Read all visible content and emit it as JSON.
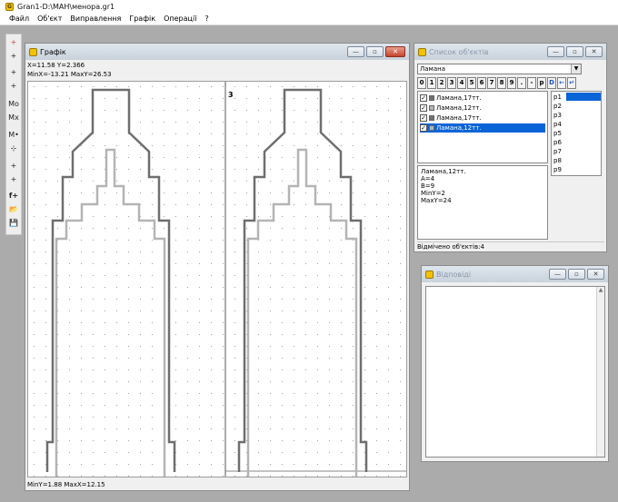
{
  "app": {
    "title": "Gran1-D:\\МАН\\менора.gr1"
  },
  "menu": [
    "Файл",
    "Об'єкт",
    "Виправлення",
    "Графік",
    "Операції",
    "?"
  ],
  "toolbar": [
    "+",
    "+",
    "+",
    "+",
    "Mo",
    "Mx",
    "M•",
    "⊹",
    "+",
    "+",
    "f+",
    "📂",
    "💾"
  ],
  "graph": {
    "title": "Графік",
    "coords": "X=11.58  Y=2.366",
    "limits_x": "MinX=-13.21  MaxY=26.53",
    "axis_label": "3",
    "status": "MinY=1.88  MaxX=12.15"
  },
  "list": {
    "title": "Список об'єктів",
    "selected_type": "Ламана",
    "buttons": [
      "0",
      "1",
      "2",
      "3",
      "4",
      "5",
      "6",
      "7",
      "8",
      "9",
      ".",
      "-",
      "p",
      "D",
      "←",
      "↵"
    ],
    "objects": [
      {
        "label": "Ламана,17тт.",
        "color": "#707070",
        "checked": true,
        "selected": false
      },
      {
        "label": "Ламана,12тт.",
        "color": "#b4b4b4",
        "checked": true,
        "selected": false
      },
      {
        "label": "Ламана,17тт.",
        "color": "#707070",
        "checked": true,
        "selected": false
      },
      {
        "label": "Ламана,12тт.",
        "color": "#b4b4b4",
        "checked": true,
        "selected": true
      }
    ],
    "params": [
      "p1",
      "p2",
      "p3",
      "p4",
      "p5",
      "p6",
      "p7",
      "p8",
      "p9"
    ],
    "properties": [
      "Ламана,12тт.",
      "A=4",
      "B=9",
      "MinY=2",
      "MaxY=24"
    ],
    "status": "Відмічено об'єктів:4"
  },
  "answers": {
    "title": "Відповіді"
  },
  "colors": {
    "outer": "#6e6e6e",
    "inner": "#b4b4b4",
    "select": "#0a64d8"
  }
}
